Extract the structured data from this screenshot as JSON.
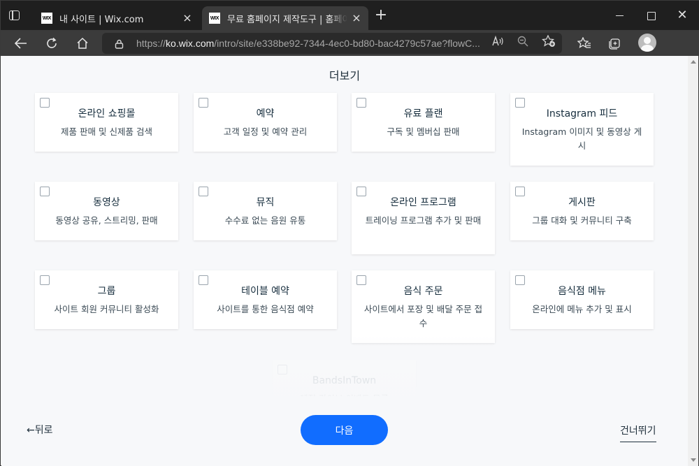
{
  "browser": {
    "tabs": [
      {
        "favicon": "WIX",
        "title": "내 사이트 | Wix.com"
      },
      {
        "favicon": "WIX",
        "title": "무료 홈페이지 제작도구 | 홈페이지"
      }
    ],
    "url": {
      "prefix": "https://",
      "host": "ko.wix.com",
      "path": "/intro/site/e338be92-7344-4ec0-bd80-bac4279c57ae?flowC..."
    },
    "icons": {
      "back": "back-arrow-icon",
      "refresh": "refresh-icon",
      "home": "home-icon",
      "lock": "lock-icon",
      "read_aloud": "read-aloud-icon",
      "zoom": "zoom-icon",
      "add_favorite": "add-favorite-icon",
      "favorites": "favorites-icon",
      "collections": "collections-icon",
      "profile": "profile-avatar-icon"
    }
  },
  "page": {
    "section_title": "더보기",
    "cards": [
      {
        "title": "온라인 쇼핑몰",
        "desc": "제품 판매 및 신제품 검색"
      },
      {
        "title": "예약",
        "desc": "고객 일정 및 예약 관리"
      },
      {
        "title": "유료 플랜",
        "desc": "구독 및 멤버십 판매"
      },
      {
        "title": "Instagram 피드",
        "desc": "Instagram 이미지 및 동영상 게시"
      },
      {
        "title": "동영상",
        "desc": "동영상 공유, 스트리밍, 판매"
      },
      {
        "title": "뮤직",
        "desc": "수수료 없는 음원 유통"
      },
      {
        "title": "온라인 프로그램",
        "desc": "트레이닝 프로그램 추가 및 판매"
      },
      {
        "title": "게시판",
        "desc": "그룹 대화 및 커뮤니티 구축"
      },
      {
        "title": "그룹",
        "desc": "사이트 회원 커뮤니티 활성화"
      },
      {
        "title": "테이블 예약",
        "desc": "사이트를 통한 음식점 예약"
      },
      {
        "title": "음식 주문",
        "desc": "사이트에서 포장 및 배달 주문 접수"
      },
      {
        "title": "음식점 메뉴",
        "desc": "온라인에 메뉴 추가 및 표시"
      },
      {
        "title": "BandsInTown",
        "desc": "예정 라이브 이벤트 목록"
      }
    ],
    "footer": {
      "back_label": "←뒤로",
      "next_label": "다음",
      "skip_label": "건너뛰기"
    }
  },
  "colors": {
    "accent": "#116dff",
    "tab_bar": "#1f1f1f",
    "nav_bar": "#3b3b3b",
    "page_bg": "#f7f8fa"
  }
}
